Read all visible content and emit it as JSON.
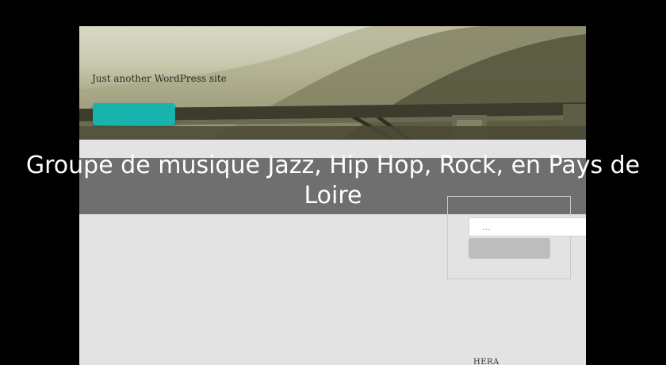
{
  "site": {
    "tagline": "Just another WordPress site",
    "menu_button_label": ""
  },
  "page": {
    "title": "Groupe de musique Jazz, Hip Hop, Rock, en Pays de Loire"
  },
  "sidebar": {
    "search": {
      "placeholder": "…",
      "button_label": ""
    },
    "widget_heading": "HERA"
  },
  "colors": {
    "background": "#000000",
    "menu_button": "#18b3ad",
    "content_background": "#e3e3e3",
    "title_band": "#6f6f6f",
    "search_button": "#bdbdbd"
  }
}
